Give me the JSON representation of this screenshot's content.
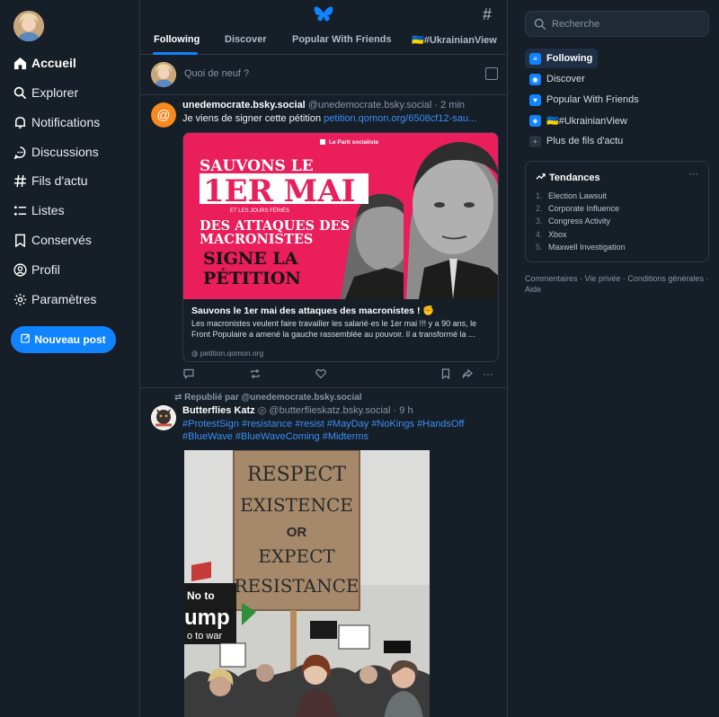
{
  "nav": {
    "items": [
      {
        "label": "Accueil",
        "icon": "home-icon"
      },
      {
        "label": "Explorer",
        "icon": "search-icon"
      },
      {
        "label": "Notifications",
        "icon": "bell-icon"
      },
      {
        "label": "Discussions",
        "icon": "chat-icon"
      },
      {
        "label": "Fils d'actu",
        "icon": "hash-icon"
      },
      {
        "label": "Listes",
        "icon": "list-icon"
      },
      {
        "label": "Conservés",
        "icon": "bookmark-icon"
      },
      {
        "label": "Profil",
        "icon": "profile-icon"
      },
      {
        "label": "Paramètres",
        "icon": "gear-icon"
      }
    ],
    "new_post_label": "Nouveau post"
  },
  "tabs": [
    "Following",
    "Discover",
    "Popular With Friends",
    "🇺🇦#UkrainianView"
  ],
  "composer": {
    "placeholder": "Quoi de neuf ?"
  },
  "post1": {
    "display_name": "unedemocrate.bsky.social",
    "handle": "@unedemocrate.bsky.social",
    "time": "· 2 min",
    "text": "Je viens de signer cette pétition",
    "link": "petition.qomon.org/6508cf12-sau...",
    "card": {
      "title": "Sauvons le 1er mai des attaques des macronistes ! ✊",
      "description": "Les macronistes veulent faire travailler les salarié·es le 1er mai !!! y a 90 ans, le Front Populaire a amené la gauche rassemblée au pouvoir. Il a transformé la ...",
      "domain": "petition.qomon.org",
      "image": {
        "line1": "SAUVONS LE",
        "line2": "1ER MAI",
        "line3": "ET LES JOURS FÉRIÉS",
        "line4": "DES ATTAQUES DES",
        "line5": "MACRONISTES",
        "line6": "SIGNE LA",
        "line7": "PÉTITION",
        "party": "Le Parti socialiste"
      }
    }
  },
  "post2": {
    "repost_label": "Republié par @unedemocrate.bsky.social",
    "display_name": "Butterflies Katz",
    "handle": "@butterflieskatz.bsky.social",
    "time": "· 9 h",
    "tags": "#ProtestSign #resistance #resist #MayDay #NoKings #HandsOff #BlueWave #BlueWaveComing #Midterms",
    "sign": [
      "RESPECT",
      "EXISTENCE",
      "OR",
      "EXPECT",
      "RESISTANCE"
    ],
    "side_sign": [
      "No to",
      "ump",
      "o to war"
    ]
  },
  "right": {
    "search_placeholder": "Recherche",
    "feeds": [
      {
        "label": "Following"
      },
      {
        "label": "Discover"
      },
      {
        "label": "Popular With Friends"
      },
      {
        "label": "🇺🇦#UkrainianView"
      },
      {
        "label": "Plus de fils d'actu"
      }
    ],
    "trends_title": "Tendances",
    "trends": [
      {
        "n": "1.",
        "label": "Election Lawsuit"
      },
      {
        "n": "2.",
        "label": "Corporate Influence"
      },
      {
        "n": "3.",
        "label": "Congress Activity"
      },
      {
        "n": "4.",
        "label": "Xbox"
      },
      {
        "n": "5.",
        "label": "Maxwell Investigation"
      }
    ],
    "footer": [
      "Commentaires",
      "Vie privée",
      "Conditions générales",
      "Aide"
    ]
  },
  "colors": {
    "accent": "#1083fe",
    "background": "#161e27",
    "link": "#3a8ff7",
    "card_pink": "#ea1d5a"
  }
}
